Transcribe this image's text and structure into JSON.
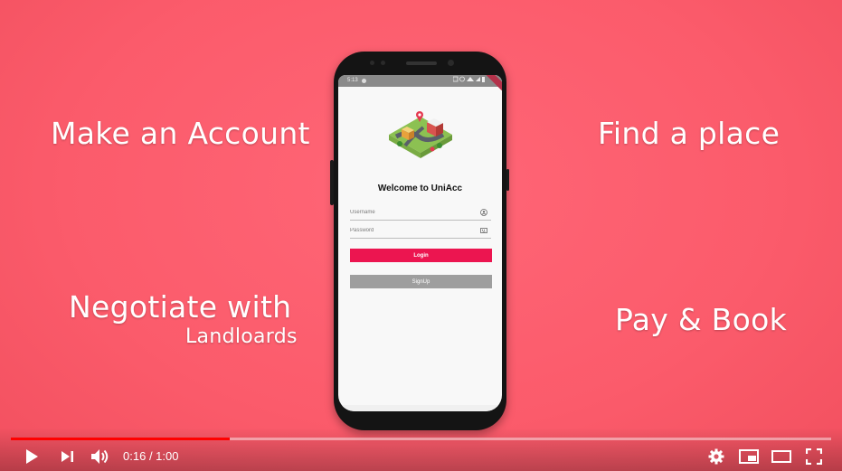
{
  "slide": {
    "features": {
      "make_account": "Make an Account",
      "find_place": "Find a place",
      "negotiate": "Negotiate with",
      "landlords": "Landloards",
      "pay_book": "Pay & Book"
    }
  },
  "phone_app": {
    "status_time": "5:13",
    "welcome": "Welcome to UniAcc",
    "username_placeholder": "Username",
    "password_placeholder": "Password",
    "login_label": "Login",
    "signup_label": "SignUp"
  },
  "player": {
    "current_time": "0:16",
    "duration": "1:00",
    "progress": 0.267
  },
  "colors": {
    "background": "#fb5c6c",
    "login_button": "#ec1550",
    "signup_button": "#9e9e9e",
    "progress": "#ff0000"
  }
}
